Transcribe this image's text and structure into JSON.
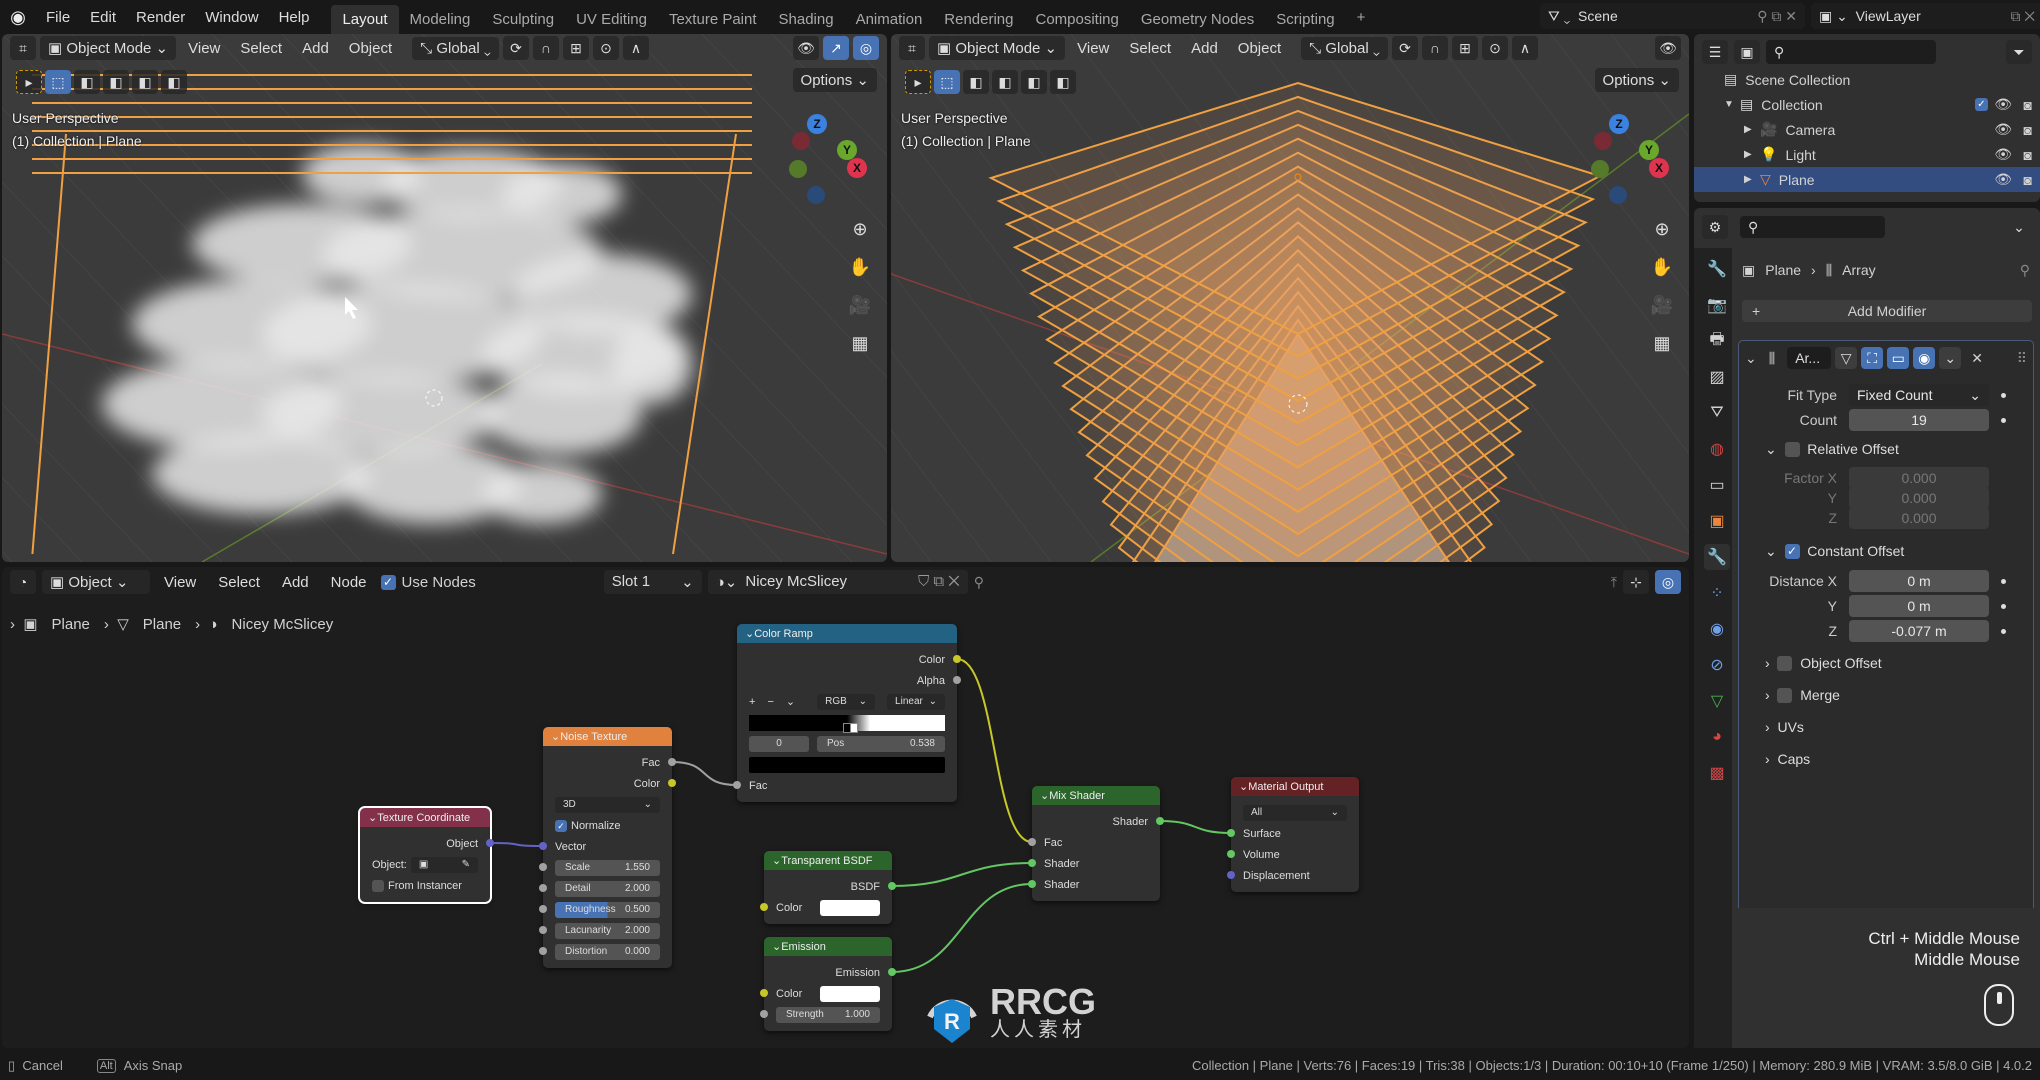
{
  "topbar": {
    "menus": [
      "File",
      "Edit",
      "Render",
      "Window",
      "Help"
    ],
    "workspaces": [
      "Layout",
      "Modeling",
      "Sculpting",
      "UV Editing",
      "Texture Paint",
      "Shading",
      "Animation",
      "Rendering",
      "Compositing",
      "Geometry Nodes",
      "Scripting"
    ],
    "active_workspace": "Layout",
    "add_workspace": "+",
    "scene": "Scene",
    "view_layer": "ViewLayer"
  },
  "viewport": {
    "mode": "Object Mode",
    "menus": [
      "View",
      "Select",
      "Add",
      "Object"
    ],
    "orientation": "Global",
    "options": "Options",
    "perspective": "User Perspective",
    "context": "(1) Collection | Plane",
    "gizmo": {
      "x": "X",
      "y": "Y",
      "z": "Z"
    }
  },
  "outliner": {
    "root": "Scene Collection",
    "items": [
      {
        "label": "Collection",
        "icon": "collection-icon",
        "level": 1
      },
      {
        "label": "Camera",
        "icon": "camera-icon",
        "level": 2
      },
      {
        "label": "Light",
        "icon": "light-icon",
        "level": 2
      },
      {
        "label": "Plane",
        "icon": "mesh-icon",
        "level": 2,
        "selected": true
      }
    ]
  },
  "properties": {
    "breadcrumb": [
      "Plane",
      "Array"
    ],
    "add_modifier": "Add Modifier",
    "modifier": {
      "name": "Ar...",
      "fit_type_label": "Fit Type",
      "fit_type": "Fixed Count",
      "count_label": "Count",
      "count": "19",
      "relative_offset": {
        "label": "Relative Offset",
        "enabled": false,
        "factor_x_label": "Factor X",
        "y_label": "Y",
        "z_label": "Z",
        "x": "0.000",
        "y": "0.000",
        "z": "0.000"
      },
      "constant_offset": {
        "label": "Constant Offset",
        "enabled": true,
        "distance_x_label": "Distance X",
        "y_label": "Y",
        "z_label": "Z",
        "x": "0 m",
        "y": "0 m",
        "z": "-0.077 m"
      },
      "object_offset": "Object Offset",
      "merge": "Merge",
      "uvs": "UVs",
      "caps": "Caps"
    }
  },
  "node_editor": {
    "type": "Object",
    "menus": [
      "View",
      "Select",
      "Add",
      "Node"
    ],
    "use_nodes": "Use Nodes",
    "slot": "Slot 1",
    "material": "Nicey McSlicey",
    "breadcrumb": [
      "Plane",
      "Plane",
      "Nicey McSlicey"
    ],
    "nodes": [
      {
        "id": "texcoord",
        "title": "Texture Coordinate",
        "color": "#83314a",
        "selected": true,
        "rows": [
          {
            "type": "out",
            "label": "Object",
            "socket": "#6363c7"
          },
          {
            "type": "objfield",
            "label": "Object:"
          },
          {
            "type": "check",
            "label": "From Instancer",
            "checked": false
          }
        ]
      },
      {
        "id": "noise",
        "title": "Noise Texture",
        "color": "#e0813d",
        "rows": [
          {
            "type": "out",
            "label": "Fac",
            "socket": "#a1a1a1"
          },
          {
            "type": "out",
            "label": "Color",
            "socket": "#c7c729"
          },
          {
            "type": "drop",
            "label": "3D"
          },
          {
            "type": "check",
            "label": "Normalize",
            "checked": true
          },
          {
            "type": "in",
            "label": "Vector",
            "socket": "#6363c7"
          },
          {
            "type": "field",
            "label": "Scale",
            "value": "1.550",
            "socket": "#a1a1a1"
          },
          {
            "type": "field",
            "label": "Detail",
            "value": "2.000",
            "socket": "#a1a1a1"
          },
          {
            "type": "field",
            "label": "Roughness",
            "value": "0.500",
            "socket": "#a1a1a1",
            "fill": 0.5
          },
          {
            "type": "field",
            "label": "Lacunarity",
            "value": "2.000",
            "socket": "#a1a1a1"
          },
          {
            "type": "field",
            "label": "Distortion",
            "value": "0.000",
            "socket": "#a1a1a1"
          }
        ]
      },
      {
        "id": "ramp",
        "title": "Color Ramp",
        "color": "#246283",
        "rows": [
          {
            "type": "out",
            "label": "Color",
            "socket": "#c7c729"
          },
          {
            "type": "out",
            "label": "Alpha",
            "socket": "#a1a1a1"
          },
          {
            "type": "ramptools",
            "add": "+",
            "remove": "−",
            "mode": "RGB",
            "interp": "Linear"
          },
          {
            "type": "rampbar",
            "stops": [
              0.5,
              0.538
            ]
          },
          {
            "type": "rampstop",
            "index": "0",
            "pos_label": "Pos",
            "pos": "0.538"
          },
          {
            "type": "swatch",
            "color": "#000000"
          },
          {
            "type": "in",
            "label": "Fac",
            "socket": "#a1a1a1"
          }
        ]
      },
      {
        "id": "transp",
        "title": "Transparent BSDF",
        "color": "#2b652b",
        "rows": [
          {
            "type": "out",
            "label": "BSDF",
            "socket": "#63c763"
          },
          {
            "type": "color",
            "label": "Color",
            "socket": "#c7c729"
          }
        ]
      },
      {
        "id": "emission",
        "title": "Emission",
        "color": "#2b652b",
        "rows": [
          {
            "type": "out",
            "label": "Emission",
            "socket": "#63c763"
          },
          {
            "type": "color",
            "label": "Color",
            "socket": "#c7c729"
          },
          {
            "type": "field",
            "label": "Strength",
            "value": "1.000",
            "socket": "#a1a1a1"
          }
        ]
      },
      {
        "id": "mix",
        "title": "Mix Shader",
        "color": "#2b652b",
        "rows": [
          {
            "type": "out",
            "label": "Shader",
            "socket": "#63c763"
          },
          {
            "type": "in",
            "label": "Fac",
            "socket": "#a1a1a1"
          },
          {
            "type": "in",
            "label": "Shader",
            "socket": "#63c763"
          },
          {
            "type": "in",
            "label": "Shader",
            "socket": "#63c763"
          }
        ]
      },
      {
        "id": "output",
        "title": "Material Output",
        "color": "#652224",
        "rows": [
          {
            "type": "drop",
            "label": "All"
          },
          {
            "type": "in",
            "label": "Surface",
            "socket": "#63c763"
          },
          {
            "type": "in",
            "label": "Volume",
            "socket": "#63c763"
          },
          {
            "type": "in",
            "label": "Displacement",
            "socket": "#6363c7"
          }
        ]
      }
    ],
    "links": [
      [
        "texcoord",
        0,
        "noise",
        4,
        "#6363c7"
      ],
      [
        "noise",
        0,
        "ramp",
        6,
        "#a1a1a1"
      ],
      [
        "ramp",
        0,
        "mix",
        1,
        "#c7c729"
      ],
      [
        "transp",
        0,
        "mix",
        2,
        "#63c763"
      ],
      [
        "emission",
        0,
        "mix",
        3,
        "#63c763"
      ],
      [
        "mix",
        0,
        "output",
        1,
        "#63c763"
      ]
    ]
  },
  "key_overlay": {
    "line1": "Ctrl + Middle Mouse",
    "line2": "Middle Mouse"
  },
  "watermark": {
    "logo": "RRCG",
    "sub": "人人素材"
  },
  "statusbar": {
    "cancel": "Cancel",
    "alt": "Alt",
    "axis_snap": "Axis Snap",
    "stats": "Collection | Plane | Verts:76 | Faces:19 | Tris:38 | Objects:1/3 | Duration: 00:10+10 (Frame 1/250) | Memory: 280.9 MiB | VRAM: 3.5/8.0 GiB | 4.0.2"
  },
  "colors": {
    "accent": "#4772b3",
    "selection": "#f0a040",
    "background": "#181818"
  }
}
